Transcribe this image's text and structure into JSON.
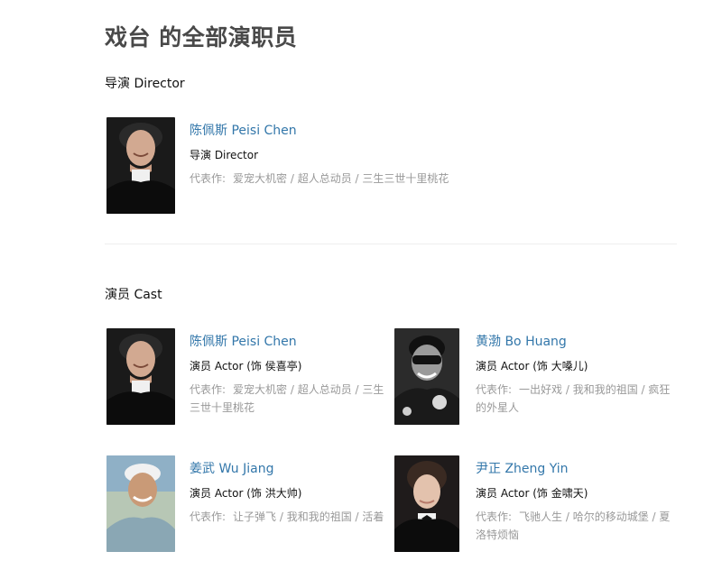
{
  "page": {
    "title": "戏台 的全部演职员"
  },
  "sections": [
    {
      "title": "导演 Director",
      "people": [
        {
          "name": "陈佩斯 Peisi Chen",
          "role": "导演 Director",
          "works_label": "代表作:",
          "works": "爱宠大机密 / 超人总动员 / 三生三世十里桃花"
        }
      ]
    },
    {
      "title": "演员 Cast",
      "people": [
        {
          "name": "陈佩斯 Peisi Chen",
          "role": "演员 Actor (饰 侯喜亭)",
          "works_label": "代表作:",
          "works_line1": "爱宠大机密 / 超人总动员 / 三生",
          "works_line2": "三世十里桃花"
        },
        {
          "name": "黄渤 Bo Huang",
          "role": "演员 Actor (饰 大嗓儿)",
          "works_label": "代表作:",
          "works_line1": "一出好戏 / 我和我的祖国 / 疯狂",
          "works_line2": "的外星人"
        },
        {
          "name": "姜武 Wu Jiang",
          "role": "演员 Actor (饰 洪大帅)",
          "works_label": "代表作:",
          "works_line1": "让子弹飞 / 我和我的祖国 / 活着"
        },
        {
          "name": "尹正 Zheng Yin",
          "role": "演员 Actor (饰 金啸天)",
          "works_label": "代表作:",
          "works_line1": "飞驰人生 / 哈尔的移动城堡 / 夏",
          "works_line2": "洛特烦恼"
        }
      ]
    }
  ]
}
